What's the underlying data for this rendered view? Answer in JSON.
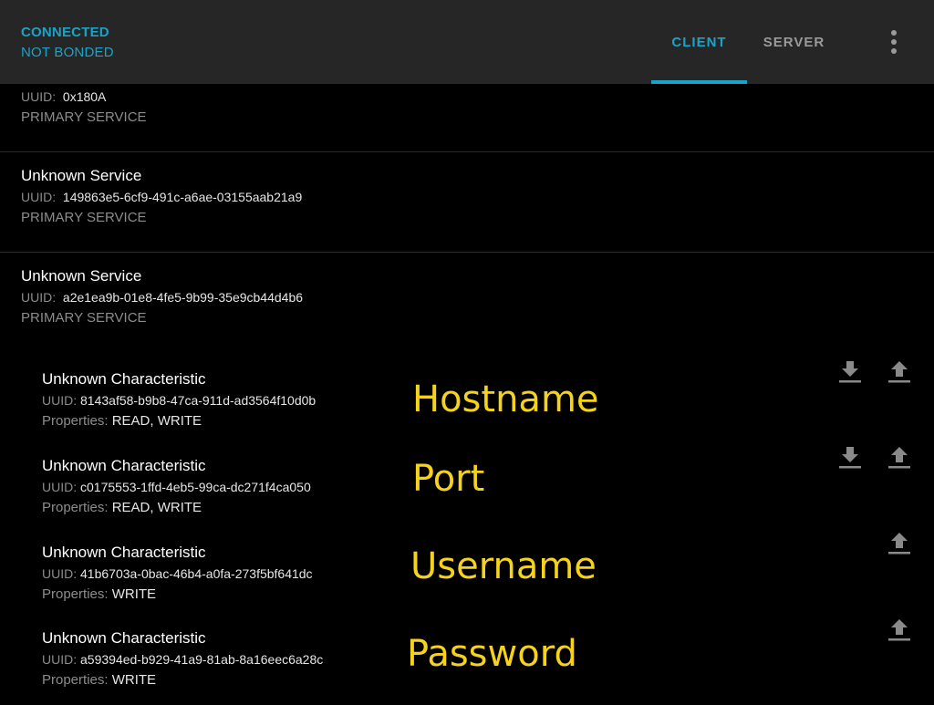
{
  "appbar": {
    "connection_status": "CONNECTED",
    "bond_status": "NOT BONDED",
    "tabs": [
      {
        "label": "CLIENT",
        "active": true
      },
      {
        "label": "SERVER",
        "active": false
      }
    ],
    "accent_color": "#1aa3c9"
  },
  "services": [
    {
      "name": "",
      "uuid_label": "UUID:",
      "uuid": "0x180A",
      "type": "PRIMARY SERVICE"
    },
    {
      "name": "Unknown Service",
      "uuid_label": "UUID:",
      "uuid": "149863e5-6cf9-491c-a6ae-03155aab21a9",
      "type": "PRIMARY SERVICE"
    },
    {
      "name": "Unknown Service",
      "uuid_label": "UUID:",
      "uuid": "a2e1ea9b-01e8-4fe5-9b99-35e9cb44d4b6",
      "type": "PRIMARY SERVICE",
      "characteristics": [
        {
          "name": "Unknown Characteristic",
          "uuid_label": "UUID:",
          "uuid": "8143af58-b9b8-47ca-911d-ad3564f10d0b",
          "properties_label": "Properties:",
          "properties": "READ, WRITE",
          "annotation": "Hostname",
          "actions": [
            "download-icon",
            "upload-icon"
          ]
        },
        {
          "name": "Unknown Characteristic",
          "uuid_label": "UUID:",
          "uuid": "c0175553-1ffd-4eb5-99ca-dc271f4ca050",
          "properties_label": "Properties:",
          "properties": "READ, WRITE",
          "annotation": "Port",
          "actions": [
            "download-icon",
            "upload-icon"
          ]
        },
        {
          "name": "Unknown Characteristic",
          "uuid_label": "UUID:",
          "uuid": "41b6703a-0bac-46b4-a0fa-273f5bf641dc",
          "properties_label": "Properties:",
          "properties": "WRITE",
          "annotation": "Username",
          "actions": [
            "upload-icon"
          ]
        },
        {
          "name": "Unknown Characteristic",
          "uuid_label": "UUID:",
          "uuid": "a59394ed-b929-41a9-81ab-8a16eec6a28c",
          "properties_label": "Properties:",
          "properties": "WRITE",
          "annotation": "Password",
          "actions": [
            "upload-icon"
          ]
        }
      ]
    }
  ]
}
